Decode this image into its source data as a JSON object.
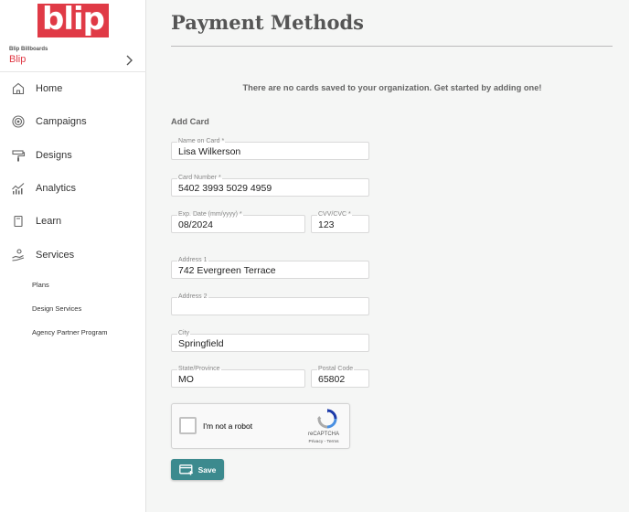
{
  "brand": {
    "logo_text": "blip",
    "accent_color": "#e03a46"
  },
  "organization": {
    "subtitle": "Blip Billboards",
    "name": "Blip"
  },
  "sidebar": {
    "items": [
      {
        "label": "Home",
        "icon": "home-icon"
      },
      {
        "label": "Campaigns",
        "icon": "target-icon"
      },
      {
        "label": "Designs",
        "icon": "paint-roller-icon"
      },
      {
        "label": "Analytics",
        "icon": "analytics-chart-icon"
      },
      {
        "label": "Learn",
        "icon": "book-icon"
      },
      {
        "label": "Services",
        "icon": "hand-service-icon"
      }
    ],
    "sub_items": [
      "Plans",
      "Design Services",
      "Agency Partner Program"
    ]
  },
  "page": {
    "title": "Payment Methods",
    "empty_message": "There are no cards saved to your organization. Get started by adding one!",
    "section_label": "Add Card"
  },
  "form": {
    "name_on_card": {
      "label": "Name on Card *",
      "value": "Lisa Wilkerson"
    },
    "card_number": {
      "label": "Card Number *",
      "value": "5402 3993 5029 4959"
    },
    "exp_date": {
      "label": "Exp. Date (mm/yyyy) *",
      "value": "08/2024"
    },
    "cvv": {
      "label": "CVV/CVC *",
      "value": "123"
    },
    "address1": {
      "label": "Address 1",
      "value": "742 Evergreen Terrace"
    },
    "address2": {
      "label": "Address 2",
      "value": ""
    },
    "city": {
      "label": "City",
      "value": "Springfield"
    },
    "state": {
      "label": "State/Province",
      "value": "MO"
    },
    "postal": {
      "label": "Postal Code",
      "value": "65802"
    }
  },
  "captcha": {
    "label": "I'm not a robot",
    "brand": "reCAPTCHA",
    "terms": "Privacy - Terms",
    "checked": false
  },
  "save_button": {
    "label": "Save",
    "icon": "add-card-icon",
    "color": "#3c8a8e"
  }
}
